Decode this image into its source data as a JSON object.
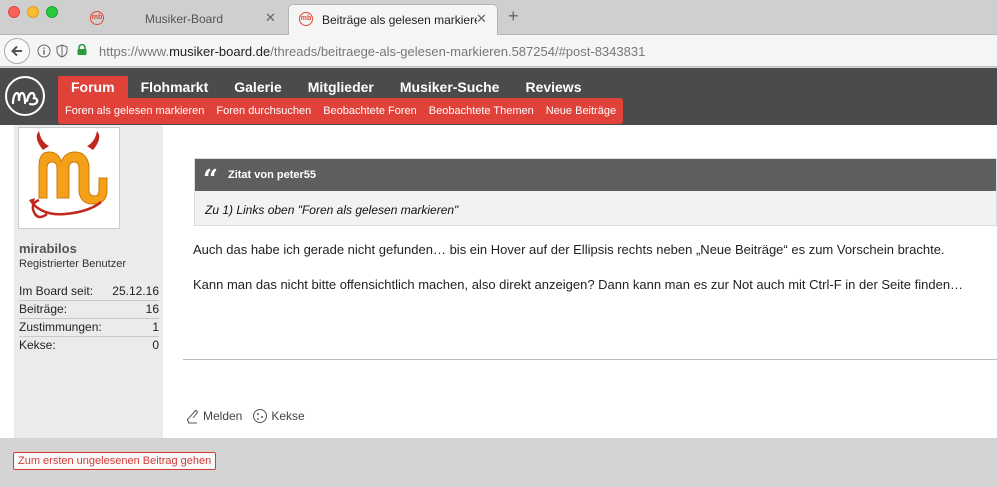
{
  "browser": {
    "tabs": [
      {
        "title": "Musiker-Board"
      },
      {
        "title": "Beiträge als gelesen markieren"
      }
    ],
    "url": {
      "scheme": "https://www.",
      "domain": "musiker-board.de",
      "path": "/threads/beitraege-als-gelesen-markieren.587254/#post-8343831"
    }
  },
  "nav": {
    "main": [
      "Forum",
      "Flohmarkt",
      "Galerie",
      "Mitglieder",
      "Musiker-Suche",
      "Reviews"
    ],
    "sub": [
      "Foren als gelesen markieren",
      "Foren durchsuchen",
      "Beobachtete Foren",
      "Beobachtete Themen",
      "Neue Beiträge"
    ]
  },
  "user": {
    "name": "mirabilos",
    "title": "Registrierter Benutzer",
    "stats": [
      {
        "label": "Im Board seit:",
        "value": "25.12.16"
      },
      {
        "label": "Beiträge:",
        "value": "16"
      },
      {
        "label": "Zustimmungen:",
        "value": "1"
      },
      {
        "label": "Kekse:",
        "value": "0"
      }
    ]
  },
  "post": {
    "quote_author": "Zitat von peter55",
    "quote_text": "Zu 1) Links oben \"Foren als gelesen markieren\"",
    "paragraph1": "Auch das habe ich gerade nicht gefunden… bis ein Hover auf der Ellipsis rechts neben „Neue Beiträge“ es zum Vorschein brachte.",
    "paragraph2": "Kann man das nicht bitte offensichtlich machen, also direkt anzeigen? Dann kann man es zur Not auch mit Ctrl-F in der Seite finden…",
    "actions": {
      "report": "Melden",
      "cookie": "Kekse"
    }
  },
  "footer": {
    "unread_button": "Zum ersten ungelesenen Beitrag gehen"
  },
  "colors": {
    "accent": "#e0423a",
    "nav_bg": "#4b4b4b",
    "quote_head": "#5e5e5e"
  }
}
